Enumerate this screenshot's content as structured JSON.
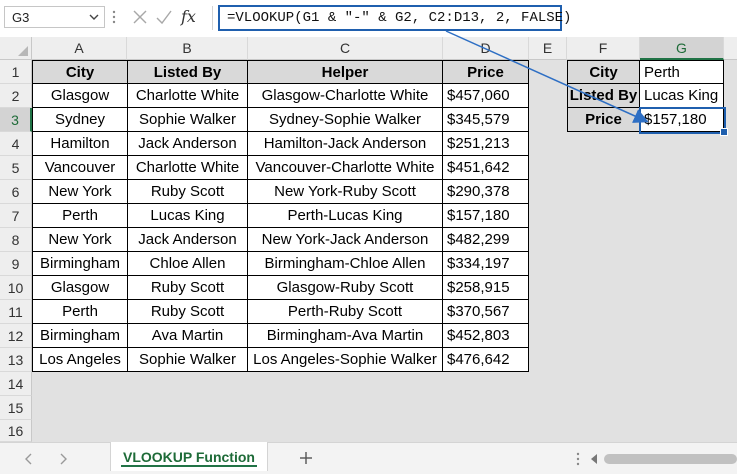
{
  "formula_bar": {
    "name_box": "G3",
    "fx_label": "fx",
    "formula": "=VLOOKUP(G1 & \"-\" & G2, C2:D13, 2, FALSE)"
  },
  "columns": [
    "A",
    "B",
    "C",
    "D",
    "E",
    "F",
    "G"
  ],
  "selected_column": "G",
  "rows": [
    "1",
    "2",
    "3",
    "4",
    "5",
    "6",
    "7",
    "8",
    "9",
    "10",
    "11",
    "12",
    "13",
    "14",
    "15",
    "16"
  ],
  "selected_row": "3",
  "table": {
    "headers": [
      "City",
      "Listed By",
      "Helper",
      "Price"
    ],
    "rows": [
      [
        "Glasgow",
        "Charlotte White",
        "Glasgow-Charlotte White",
        "$457,060"
      ],
      [
        "Sydney",
        "Sophie Walker",
        "Sydney-Sophie Walker",
        "$345,579"
      ],
      [
        "Hamilton",
        "Jack Anderson",
        "Hamilton-Jack Anderson",
        "$251,213"
      ],
      [
        "Vancouver",
        "Charlotte White",
        "Vancouver-Charlotte White",
        "$451,642"
      ],
      [
        "New York",
        "Ruby Scott",
        "New York-Ruby Scott",
        "$290,378"
      ],
      [
        "Perth",
        "Lucas King",
        "Perth-Lucas King",
        "$157,180"
      ],
      [
        "New York",
        "Jack Anderson",
        "New York-Jack Anderson",
        "$482,299"
      ],
      [
        "Birmingham",
        "Chloe Allen",
        "Birmingham-Chloe Allen",
        "$334,197"
      ],
      [
        "Glasgow",
        "Ruby Scott",
        "Glasgow-Ruby Scott",
        "$258,915"
      ],
      [
        "Perth",
        "Ruby Scott",
        "Perth-Ruby Scott",
        "$370,567"
      ],
      [
        "Birmingham",
        "Ava Martin",
        "Birmingham-Ava Martin",
        "$452,803"
      ],
      [
        "Los Angeles",
        "Sophie Walker",
        "Los Angeles-Sophie Walker",
        "$476,642"
      ]
    ]
  },
  "lookup": [
    {
      "label": "City",
      "value": "Perth"
    },
    {
      "label": "Listed By",
      "value": "Lucas King"
    },
    {
      "label": "Price",
      "value": "$157,180"
    }
  ],
  "sheet_tabs": {
    "active": "VLOOKUP Function",
    "add_symbol": "+"
  },
  "colors": {
    "header_fill": "#d9d9d9",
    "selection_border": "#1f5fae",
    "excel_green": "#217346",
    "arrow": "#2e6fc4"
  },
  "icons": [
    "chevron-down-icon",
    "cancel-x-icon",
    "checkmark-icon",
    "fx-icon",
    "chevron-left-icon",
    "chevron-right-icon",
    "plus-icon"
  ]
}
